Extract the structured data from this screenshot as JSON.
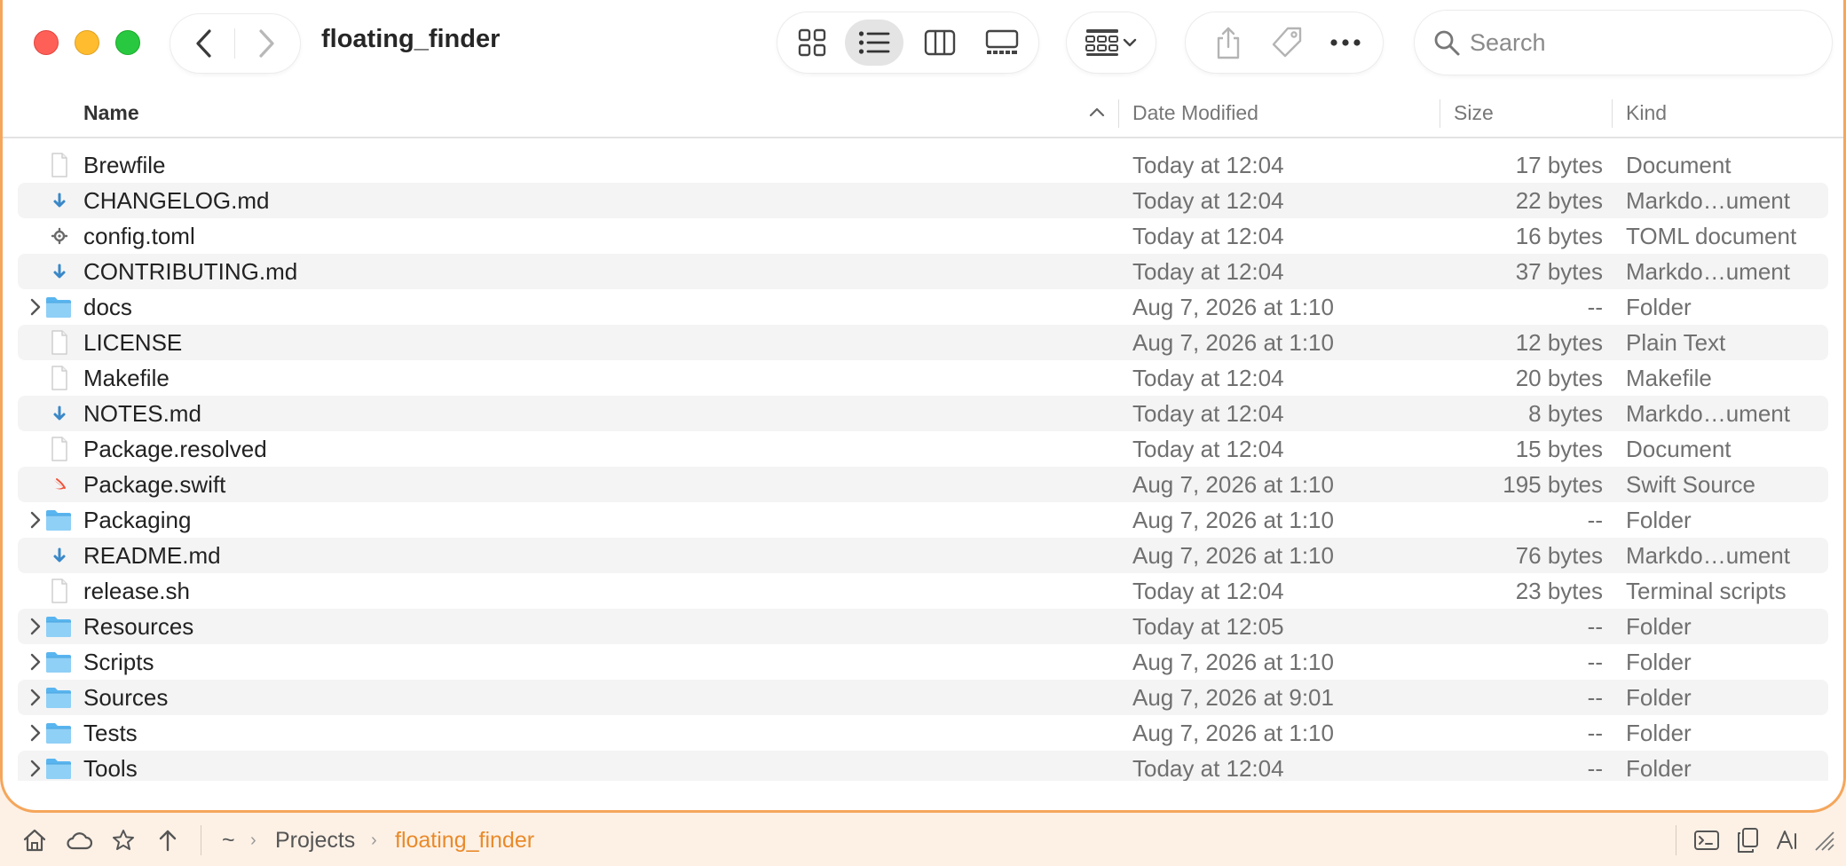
{
  "window": {
    "title": "floating_finder"
  },
  "toolbar": {
    "search_placeholder": "Search",
    "view_modes": [
      "icon-view",
      "list-view",
      "column-view",
      "gallery-view"
    ],
    "active_view": "list-view",
    "accent_color": "#f5a65b"
  },
  "columns": {
    "name": "Name",
    "date": "Date Modified",
    "size": "Size",
    "kind": "Kind"
  },
  "files": [
    {
      "name": "Brewfile",
      "date": "Today at 12:04",
      "size": "17 bytes",
      "kind": "Document",
      "type": "doc"
    },
    {
      "name": "CHANGELOG.md",
      "date": "Today at 12:04",
      "size": "22 bytes",
      "kind": "Markdo…ument",
      "type": "md"
    },
    {
      "name": "config.toml",
      "date": "Today at 12:04",
      "size": "16 bytes",
      "kind": "TOML document",
      "type": "gear"
    },
    {
      "name": "CONTRIBUTING.md",
      "date": "Today at 12:04",
      "size": "37 bytes",
      "kind": "Markdo…ument",
      "type": "md"
    },
    {
      "name": "docs",
      "date": "Aug 7, 2026 at 1:10",
      "size": "--",
      "kind": "Folder",
      "type": "folder"
    },
    {
      "name": "LICENSE",
      "date": "Aug 7, 2026 at 1:10",
      "size": "12 bytes",
      "kind": "Plain Text",
      "type": "doc"
    },
    {
      "name": "Makefile",
      "date": "Today at 12:04",
      "size": "20 bytes",
      "kind": "Makefile",
      "type": "doc"
    },
    {
      "name": "NOTES.md",
      "date": "Today at 12:04",
      "size": "8 bytes",
      "kind": "Markdo…ument",
      "type": "md"
    },
    {
      "name": "Package.resolved",
      "date": "Today at 12:04",
      "size": "15 bytes",
      "kind": "Document",
      "type": "doc"
    },
    {
      "name": "Package.swift",
      "date": "Aug 7, 2026 at 1:10",
      "size": "195 bytes",
      "kind": "Swift Source",
      "type": "swift"
    },
    {
      "name": "Packaging",
      "date": "Aug 7, 2026 at 1:10",
      "size": "--",
      "kind": "Folder",
      "type": "folder"
    },
    {
      "name": "README.md",
      "date": "Aug 7, 2026 at 1:10",
      "size": "76 bytes",
      "kind": "Markdo…ument",
      "type": "md"
    },
    {
      "name": "release.sh",
      "date": "Today at 12:04",
      "size": "23 bytes",
      "kind": "Terminal scripts",
      "type": "blank"
    },
    {
      "name": "Resources",
      "date": "Today at 12:05",
      "size": "--",
      "kind": "Folder",
      "type": "folder"
    },
    {
      "name": "Scripts",
      "date": "Aug 7, 2026 at 1:10",
      "size": "--",
      "kind": "Folder",
      "type": "folder"
    },
    {
      "name": "Sources",
      "date": "Aug 7, 2026 at 9:01",
      "size": "--",
      "kind": "Folder",
      "type": "folder"
    },
    {
      "name": "Tests",
      "date": "Aug 7, 2026 at 1:10",
      "size": "--",
      "kind": "Folder",
      "type": "folder"
    },
    {
      "name": "Tools",
      "date": "Today at 12:04",
      "size": "--",
      "kind": "Folder",
      "type": "folder"
    }
  ],
  "pathbar": {
    "crumbs": [
      "~",
      "Projects",
      "floating_finder"
    ],
    "current_color": "#e98a2a"
  }
}
